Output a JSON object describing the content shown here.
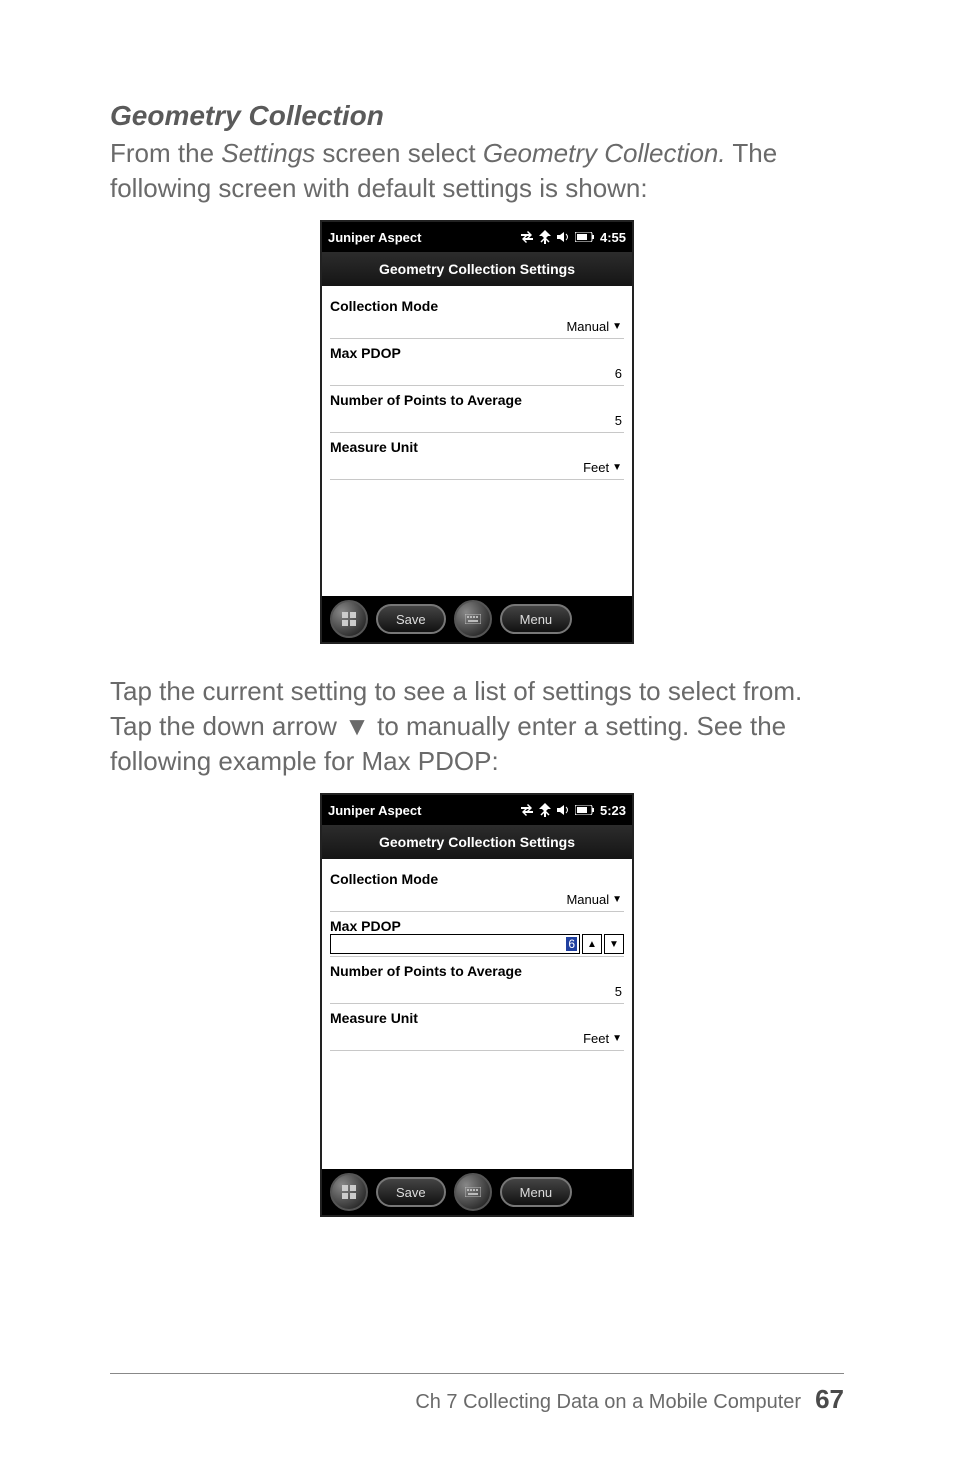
{
  "heading1": "Geometry Collection",
  "para1_a": "From the ",
  "para1_b": "Settings",
  "para1_c": " screen select ",
  "para1_d": "Geometry Collection.",
  "para1_e": " The following screen with default settings is shown:",
  "para2_a": "Tap the current setting to see a list of settings to select from. Tap the down arrow ",
  "para2_arrow": "▼",
  "para2_b": " to manually enter a setting. See the following example for Max PDOP:",
  "footer_chapter": "Ch 7   Collecting Data on a Mobile Computer",
  "footer_page": "67",
  "screenshot1": {
    "app_title": "Juniper Aspect",
    "time": "4:55",
    "subheader": "Geometry Collection Settings",
    "collection_mode_label": "Collection Mode",
    "collection_mode_value": "Manual",
    "max_pdop_label": "Max PDOP",
    "max_pdop_value": "6",
    "num_points_label": "Number of Points to Average",
    "num_points_value": "5",
    "measure_unit_label": "Measure Unit",
    "measure_unit_value": "Feet",
    "save_label": "Save",
    "menu_label": "Menu"
  },
  "screenshot2": {
    "app_title": "Juniper Aspect",
    "time": "5:23",
    "subheader": "Geometry Collection Settings",
    "collection_mode_label": "Collection Mode",
    "collection_mode_value": "Manual",
    "max_pdop_label": "Max PDOP",
    "max_pdop_value": "6",
    "num_points_label": "Number of Points to Average",
    "num_points_value": "5",
    "measure_unit_label": "Measure Unit",
    "measure_unit_value": "Feet",
    "save_label": "Save",
    "menu_label": "Menu"
  }
}
